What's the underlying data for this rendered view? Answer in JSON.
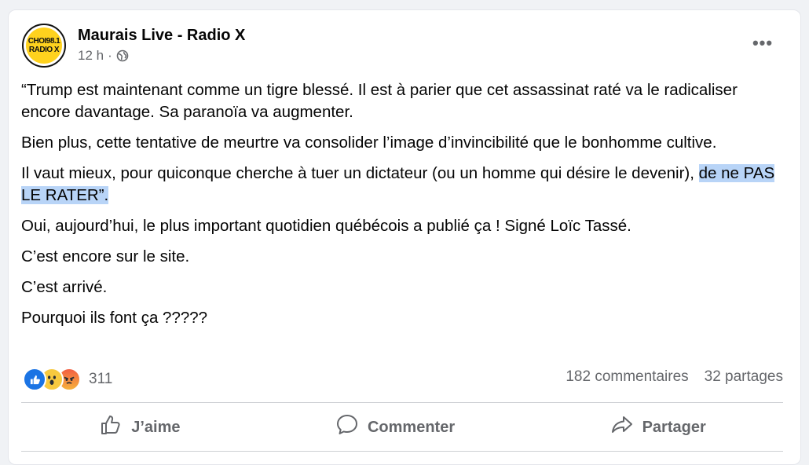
{
  "post": {
    "page_name": "Maurais Live - Radio X",
    "time": "12 h",
    "separator": "·",
    "avatar_logo": {
      "top": "CHOI98.1",
      "bottom": "RADIO X"
    },
    "paragraphs": [
      "“Trump est maintenant comme un tigre blessé. Il est à parier que cet assassinat raté va le radicaliser encore davantage. Sa paranoïa va augmenter.",
      "Bien plus, cette tentative de meurtre va consolider l’image d’invincibilité que le bonhomme cultive.",
      "Il vaut mieux, pour quiconque cherche à tuer un dictateur (ou un homme qui désire le devenir),",
      "Oui, aujourd’hui, le plus important quotidien québécois a publié ça ! Signé Loïc Tassé.",
      "C’est encore sur le site.",
      "C’est arrivé.",
      "Pourquoi ils font ça ?????"
    ],
    "highlighted": "de ne PAS LE RATER”."
  },
  "reactions": {
    "icons": [
      "like-icon",
      "wow-icon",
      "angry-icon"
    ],
    "count": "311"
  },
  "stats": {
    "comments": "182 commentaires",
    "shares": "32 partages"
  },
  "actions": {
    "like": "J’aime",
    "comment": "Commenter",
    "share": "Partager"
  },
  "colors": {
    "highlight": "#b8d4f7",
    "secondary_text": "#65676b",
    "like_blue": "#1b74e4"
  }
}
